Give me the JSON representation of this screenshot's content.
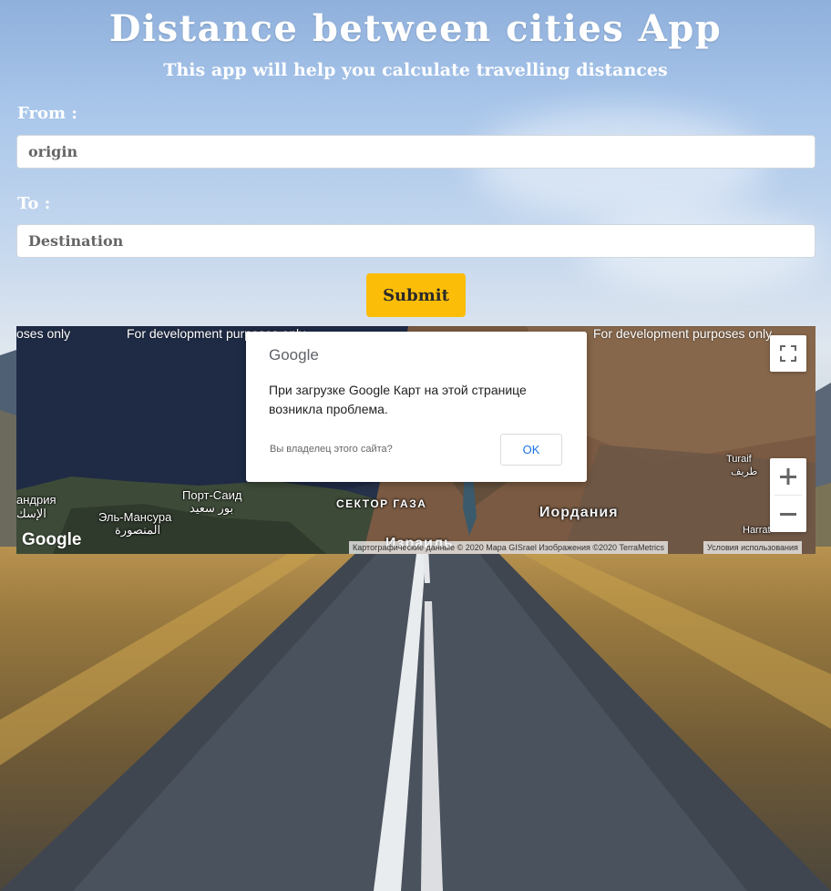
{
  "header": {
    "title": "Distance between cities App",
    "subtitle": "This app will help you calculate travelling distances"
  },
  "form": {
    "from_label": "From :",
    "from_placeholder": "origin",
    "to_label": "To :",
    "to_placeholder": "Destination",
    "submit_label": "Submit"
  },
  "map": {
    "dev_watermark": "For development purposes only",
    "dev_watermark_clipped": "oses only",
    "labels": {
      "alexandria": "андрия",
      "alexandria_ar": "الإسك",
      "el_mansoura": "Эль-Мансура",
      "el_mansoura_ar": "المنصورة",
      "port_said": "Порт-Саид",
      "port_said_ar": "بور سعيد",
      "gaza": "СЕКТОР ГАЗА",
      "jordan": "Иордания",
      "israel_partial": "Израиль",
      "turaif": "Turaif",
      "turaif_ar": "طريف",
      "harrat": "Harrat"
    },
    "google_logo": "Google",
    "attribution": "Картографические данные © 2020 Mapa GISrael Изображения ©2020 TerraMetrics",
    "terms": "Условия использования",
    "controls": {
      "fullscreen_icon": "fullscreen-icon",
      "zoom_in_icon": "plus-icon",
      "zoom_out_icon": "minus-icon"
    }
  },
  "dialog": {
    "brand": "Google",
    "message": "При загрузке Google Карт на этой странице возникла проблема.",
    "owner_question": "Вы владелец этого сайта?",
    "ok_label": "OK"
  },
  "colors": {
    "submit_bg": "#fbbd08",
    "dialog_ok_text": "#1a73e8"
  }
}
